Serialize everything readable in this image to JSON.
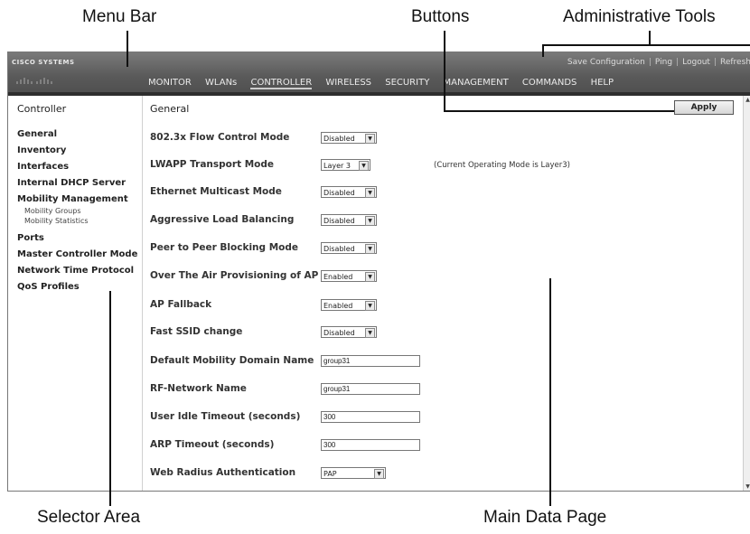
{
  "callouts": {
    "menu_bar": "Menu Bar",
    "buttons": "Buttons",
    "admin_tools": "Administrative Tools",
    "selector_area": "Selector Area",
    "main_data_page": "Main Data Page"
  },
  "header": {
    "logo": "CISCO SYSTEMS",
    "admin_links": [
      "Save Configuration",
      "Ping",
      "Logout",
      "Refresh"
    ],
    "nav": [
      "MONITOR",
      "WLANs",
      "CONTROLLER",
      "WIRELESS",
      "SECURITY",
      "MANAGEMENT",
      "COMMANDS",
      "HELP"
    ],
    "active_nav": "CONTROLLER"
  },
  "sidebar": {
    "title": "Controller",
    "items": [
      "General",
      "Inventory",
      "Interfaces",
      "Internal DHCP Server",
      "Mobility Management"
    ],
    "subitems": [
      "Mobility Groups",
      "Mobility Statistics"
    ],
    "items2": [
      "Ports",
      "Master Controller Mode",
      "Network Time Protocol",
      "QoS Profiles"
    ]
  },
  "main": {
    "title": "General",
    "apply_label": "Apply",
    "current_mode_note": "(Current Operating Mode is Layer3)",
    "fields": [
      {
        "label": "802.3x Flow Control Mode",
        "value": "Disabled"
      },
      {
        "label": "LWAPP Transport Mode",
        "value": "Layer 3"
      },
      {
        "label": "Ethernet Multicast Mode",
        "value": "Disabled"
      },
      {
        "label": "Aggressive Load Balancing",
        "value": "Disabled"
      },
      {
        "label": "Peer to Peer Blocking Mode",
        "value": "Disabled"
      },
      {
        "label": "Over The Air Provisioning of AP",
        "value": "Enabled"
      },
      {
        "label": "AP Fallback",
        "value": "Enabled"
      },
      {
        "label": "Fast SSID change",
        "value": "Disabled"
      },
      {
        "label": "Default Mobility Domain Name",
        "value": "group31"
      },
      {
        "label": "RF-Network Name",
        "value": "group31"
      },
      {
        "label": "User Idle Timeout (seconds)",
        "value": "300"
      },
      {
        "label": "ARP Timeout (seconds)",
        "value": "300"
      },
      {
        "label": "Web Radius Authentication",
        "value": "PAP"
      }
    ]
  }
}
